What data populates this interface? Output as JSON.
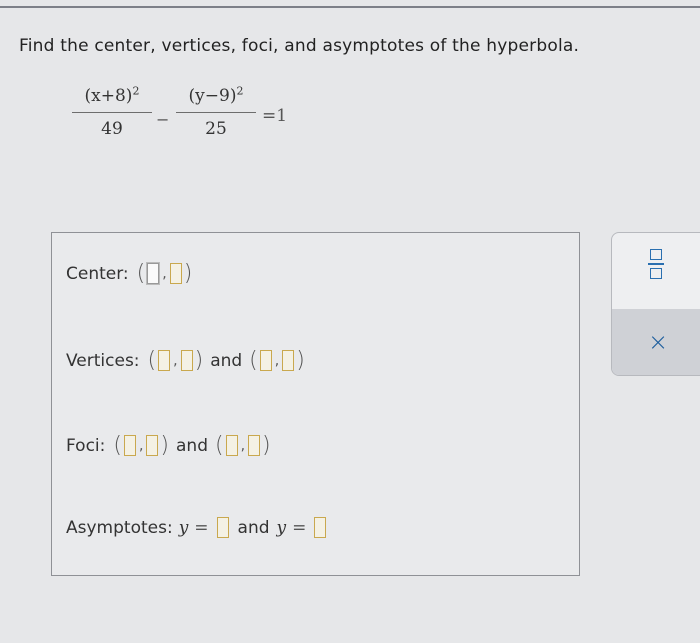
{
  "question": {
    "text": "Find the center, vertices, foci, and asymptotes of the hyperbola."
  },
  "equation": {
    "term1_num": "(x+8)",
    "term1_exp": "2",
    "term1_den": "49",
    "minus": "−",
    "term2_num": "(y−9)",
    "term2_exp": "2",
    "term2_den": "25",
    "rhs": "=1"
  },
  "answer": {
    "center_label": "Center:",
    "vertices_label": "Vertices:",
    "foci_label": "Foci:",
    "asymptotes_label": "Asymptotes:",
    "and": "and",
    "comma": ",",
    "open_paren": "(",
    "close_paren": ")",
    "y_var": "y",
    "equals": "="
  },
  "tools": {
    "fraction_icon": "fraction-icon",
    "close_symbol": "×"
  },
  "colors": {
    "background": "#e6e7e9",
    "slot_border": "#c9a84e",
    "tool_accent": "#2a6fb0"
  }
}
